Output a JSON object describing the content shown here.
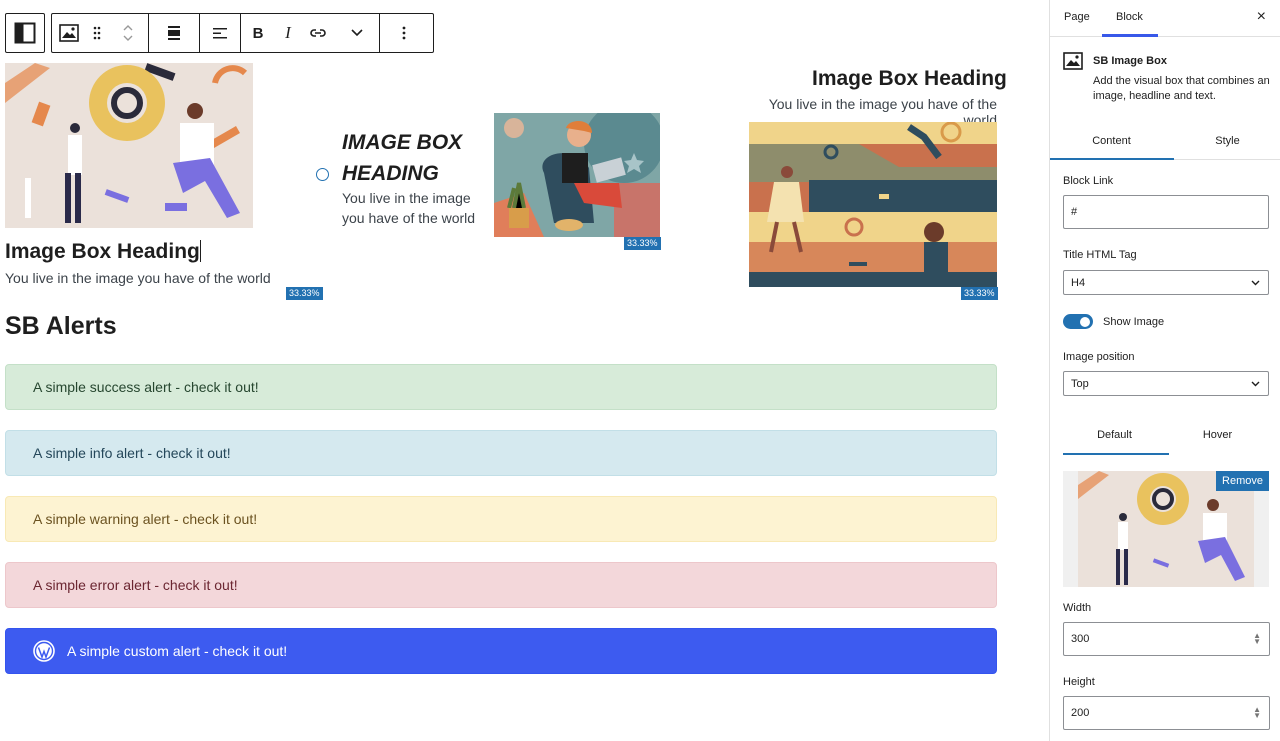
{
  "toolbar": {
    "buttons": [
      "sidebar-toggle",
      "image-box",
      "drag",
      "move",
      "align",
      "text-align",
      "bold",
      "italic",
      "link",
      "more-rich-text",
      "options"
    ],
    "bold_label": "B",
    "italic_label": "I"
  },
  "image_boxes": [
    {
      "heading": "Image Box Heading",
      "text": "You live in the image you have of the world",
      "width_badge": "33.33%"
    },
    {
      "heading_line1": "IMAGE BOX",
      "heading_line2": "HEADING",
      "text_line1": "You live in the image",
      "text_line2": "you have of the world",
      "width_badge": "33.33%"
    },
    {
      "heading": "Image Box Heading",
      "text": "You live in the image you have of the world",
      "width_badge": "33.33%"
    }
  ],
  "alerts": {
    "title": "SB Alerts",
    "success": "A simple success alert - check it out!",
    "info": "A simple info alert - check it out!",
    "warning": "A simple warning alert - check it out!",
    "error": "A simple error alert - check it out!",
    "custom": "A simple custom alert - check it out!"
  },
  "sidebar": {
    "tabs": {
      "page": "Page",
      "block": "Block"
    },
    "close_icon": "×",
    "block_card": {
      "title": "SB Image Box",
      "description": "Add the visual box that combines an image, headline and text."
    },
    "panel_tabs": {
      "content": "Content",
      "style": "Style"
    },
    "block_link": {
      "label": "Block Link",
      "value": "#"
    },
    "title_tag": {
      "label": "Title HTML Tag",
      "value": "H4"
    },
    "show_image": {
      "label": "Show Image",
      "enabled": true
    },
    "image_position": {
      "label": "Image position",
      "value": "Top"
    },
    "state_tabs": {
      "default": "Default",
      "hover": "Hover"
    },
    "remove_label": "Remove",
    "width": {
      "label": "Width",
      "value": "300"
    },
    "height": {
      "label": "Height",
      "value": "200"
    }
  },
  "colors": {
    "accent": "#2271b1",
    "wp_blue": "#3858e9",
    "custom_alert": "#3d5bf0"
  }
}
